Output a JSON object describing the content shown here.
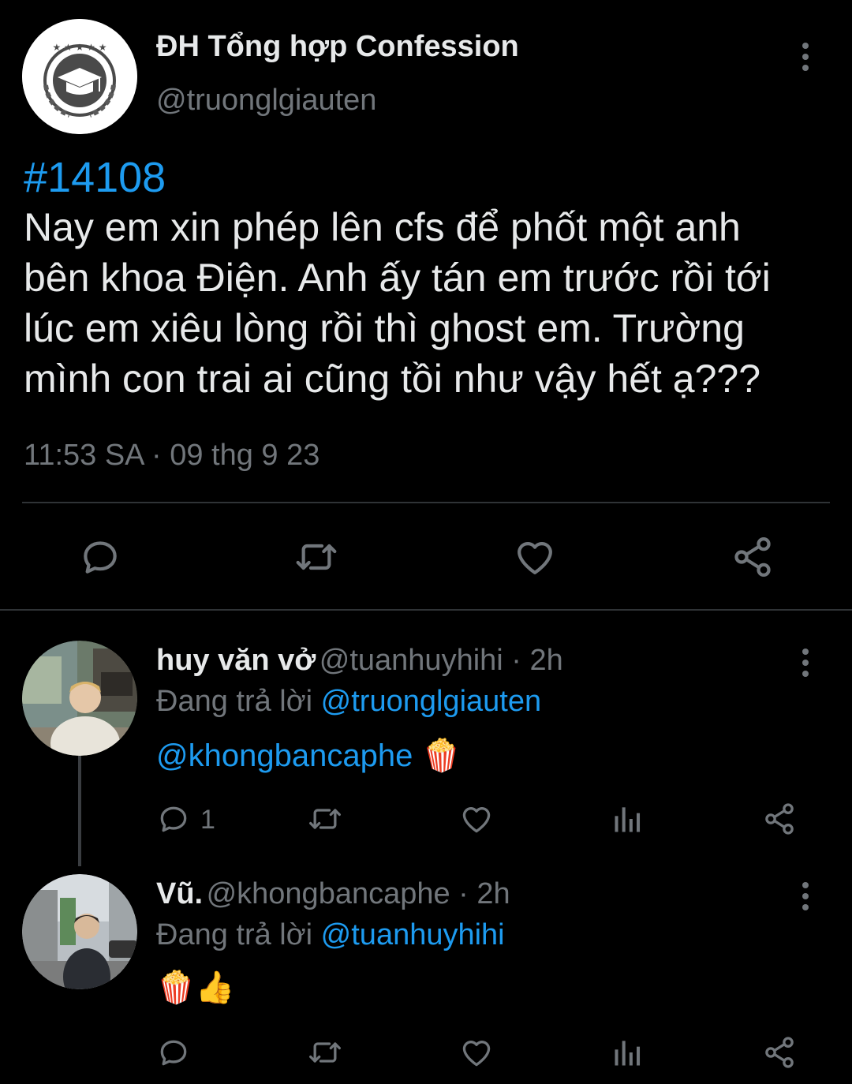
{
  "tweet": {
    "author_name": "ĐH Tổng hợp Confession",
    "author_handle": "@truonglgiauten",
    "hashtag": "#14108",
    "body": "Nay em xin phép lên cfs để phốt một anh\nbên khoa Điện. Anh ấy tán em trước rồi tới\nlúc em xiêu lòng rồi thì ghost em. Trường\nmình con trai ai cũng tồi như vậy hết ạ???",
    "timestamp": "11:53 SA · 09 thg 9 23",
    "actions": [
      "reply-icon",
      "retweet-icon",
      "like-icon",
      "share-icon"
    ]
  },
  "replies": [
    {
      "name": "huy văn vở",
      "handle": "@tuanhuyhihi · 2h",
      "replying_label": "Đang trả lời",
      "replying_to": "@truonglgiauten",
      "text_link": "@khongbancaphe",
      "emoji": "🍿",
      "reply_count": "1"
    },
    {
      "name": "Vũ.",
      "handle": "@khongbancaphe · 2h",
      "replying_label": "Đang trả lời",
      "replying_to": "@tuanhuyhihi",
      "emoji": "🍿👍"
    }
  ],
  "colors": {
    "background": "#000000",
    "text": "#e7e9ea",
    "muted": "#71767b",
    "link": "#1d9bf0",
    "divider": "#2f3336"
  }
}
